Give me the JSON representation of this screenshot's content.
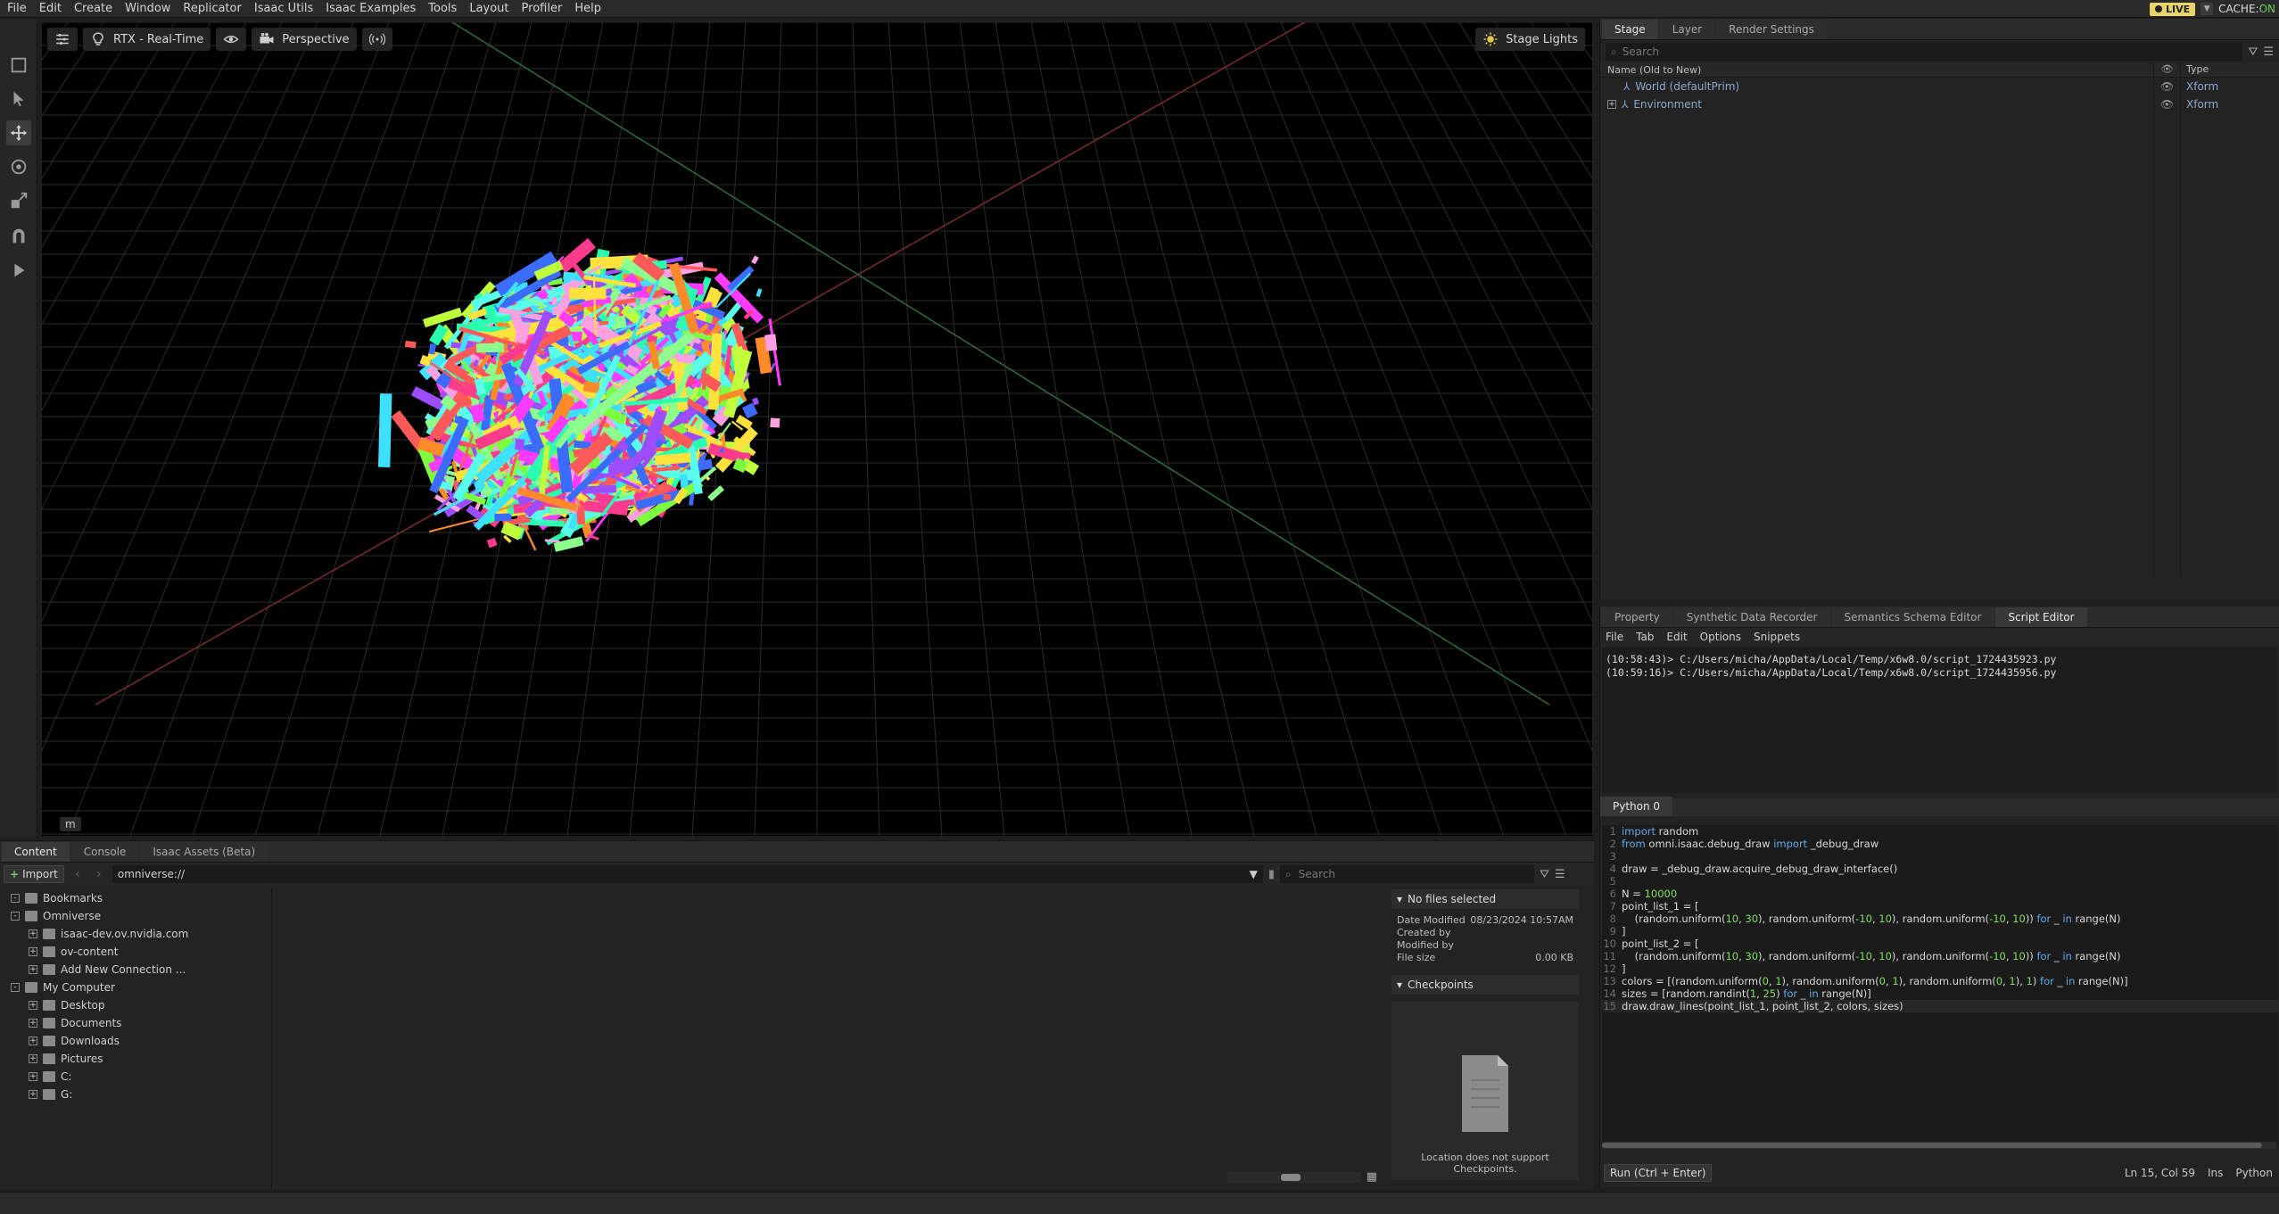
{
  "menu": {
    "items": [
      "File",
      "Edit",
      "Create",
      "Window",
      "Replicator",
      "Isaac Utils",
      "Isaac Examples",
      "Tools",
      "Layout",
      "Profiler",
      "Help"
    ],
    "live_label": "LIVE",
    "cache_label": "CACHE:",
    "cache_state": "ON"
  },
  "viewport": {
    "renderer_label": "RTX - Real-Time",
    "camera_label": "Perspective",
    "stage_lights_label": "Stage Lights",
    "units_badge": "m"
  },
  "stage": {
    "tabs": [
      "Stage",
      "Layer",
      "Render Settings"
    ],
    "search_placeholder": "Search",
    "col_name": "Name (Old to New)",
    "col_type": "Type",
    "rows": [
      {
        "name": "World (defaultPrim)",
        "type": "Xform"
      },
      {
        "name": "Environment",
        "type": "Xform"
      }
    ]
  },
  "lower_tabs": [
    "Property",
    "Synthetic Data Recorder",
    "Semantics Schema Editor",
    "Script Editor"
  ],
  "script_editor": {
    "menu": [
      "File",
      "Tab",
      "Edit",
      "Options",
      "Snippets"
    ],
    "output": [
      "(10:58:43)> C:/Users/micha/AppData/Local/Temp/x6w8.0/script_1724435923.py",
      "(10:59:16)> C:/Users/micha/AppData/Local/Temp/x6w8.0/script_1724435956.py"
    ],
    "py_tab": "Python 0",
    "code": [
      "import random",
      "from omni.isaac.debug_draw import _debug_draw",
      "",
      "draw = _debug_draw.acquire_debug_draw_interface()",
      "",
      "N = 10000",
      "point_list_1 = [",
      "    (random.uniform(10, 30), random.uniform(-10, 10), random.uniform(-10, 10)) for _ in range(N)",
      "]",
      "point_list_2 = [",
      "    (random.uniform(10, 30), random.uniform(-10, 10), random.uniform(-10, 10)) for _ in range(N)",
      "]",
      "colors = [(random.uniform(0, 1), random.uniform(0, 1), random.uniform(0, 1), 1) for _ in range(N)]",
      "sizes = [random.randint(1, 25) for _ in range(N)]",
      "draw.draw_lines(point_list_1, point_list_2, colors, sizes)"
    ],
    "run_label": "Run (Ctrl + Enter)",
    "cursor_pos": "Ln 15, Col 59",
    "ins_label": "Ins",
    "lang_label": "Python"
  },
  "content": {
    "tabs": [
      "Content",
      "Console",
      "Isaac Assets (Beta)"
    ],
    "import_label": "Import",
    "path": "omniverse://",
    "search_placeholder": "Search",
    "tree": [
      {
        "label": "Bookmarks",
        "level": 0,
        "exp": "-"
      },
      {
        "label": "Omniverse",
        "level": 0,
        "exp": "-"
      },
      {
        "label": "isaac-dev.ov.nvidia.com",
        "level": 1,
        "exp": "+"
      },
      {
        "label": "ov-content",
        "level": 1,
        "exp": "+"
      },
      {
        "label": "Add New Connection ...",
        "level": 1,
        "exp": "+"
      },
      {
        "label": "My Computer",
        "level": 0,
        "exp": "-"
      },
      {
        "label": "Desktop",
        "level": 1,
        "exp": "+"
      },
      {
        "label": "Documents",
        "level": 1,
        "exp": "+"
      },
      {
        "label": "Downloads",
        "level": 1,
        "exp": "+"
      },
      {
        "label": "Pictures",
        "level": 1,
        "exp": "+"
      },
      {
        "label": "C:",
        "level": 1,
        "exp": "+"
      },
      {
        "label": "G:",
        "level": 1,
        "exp": "+"
      }
    ],
    "details": {
      "header": "No files selected",
      "date_modified_label": "Date Modified",
      "date_modified": "08/23/2024 10:57AM",
      "created_by_label": "Created by",
      "modified_by_label": "Modified by",
      "file_size_label": "File size",
      "file_size": "0.00 KB",
      "checkpoints_header": "Checkpoints",
      "checkpoints_msg": "Location does not support Checkpoints."
    }
  }
}
